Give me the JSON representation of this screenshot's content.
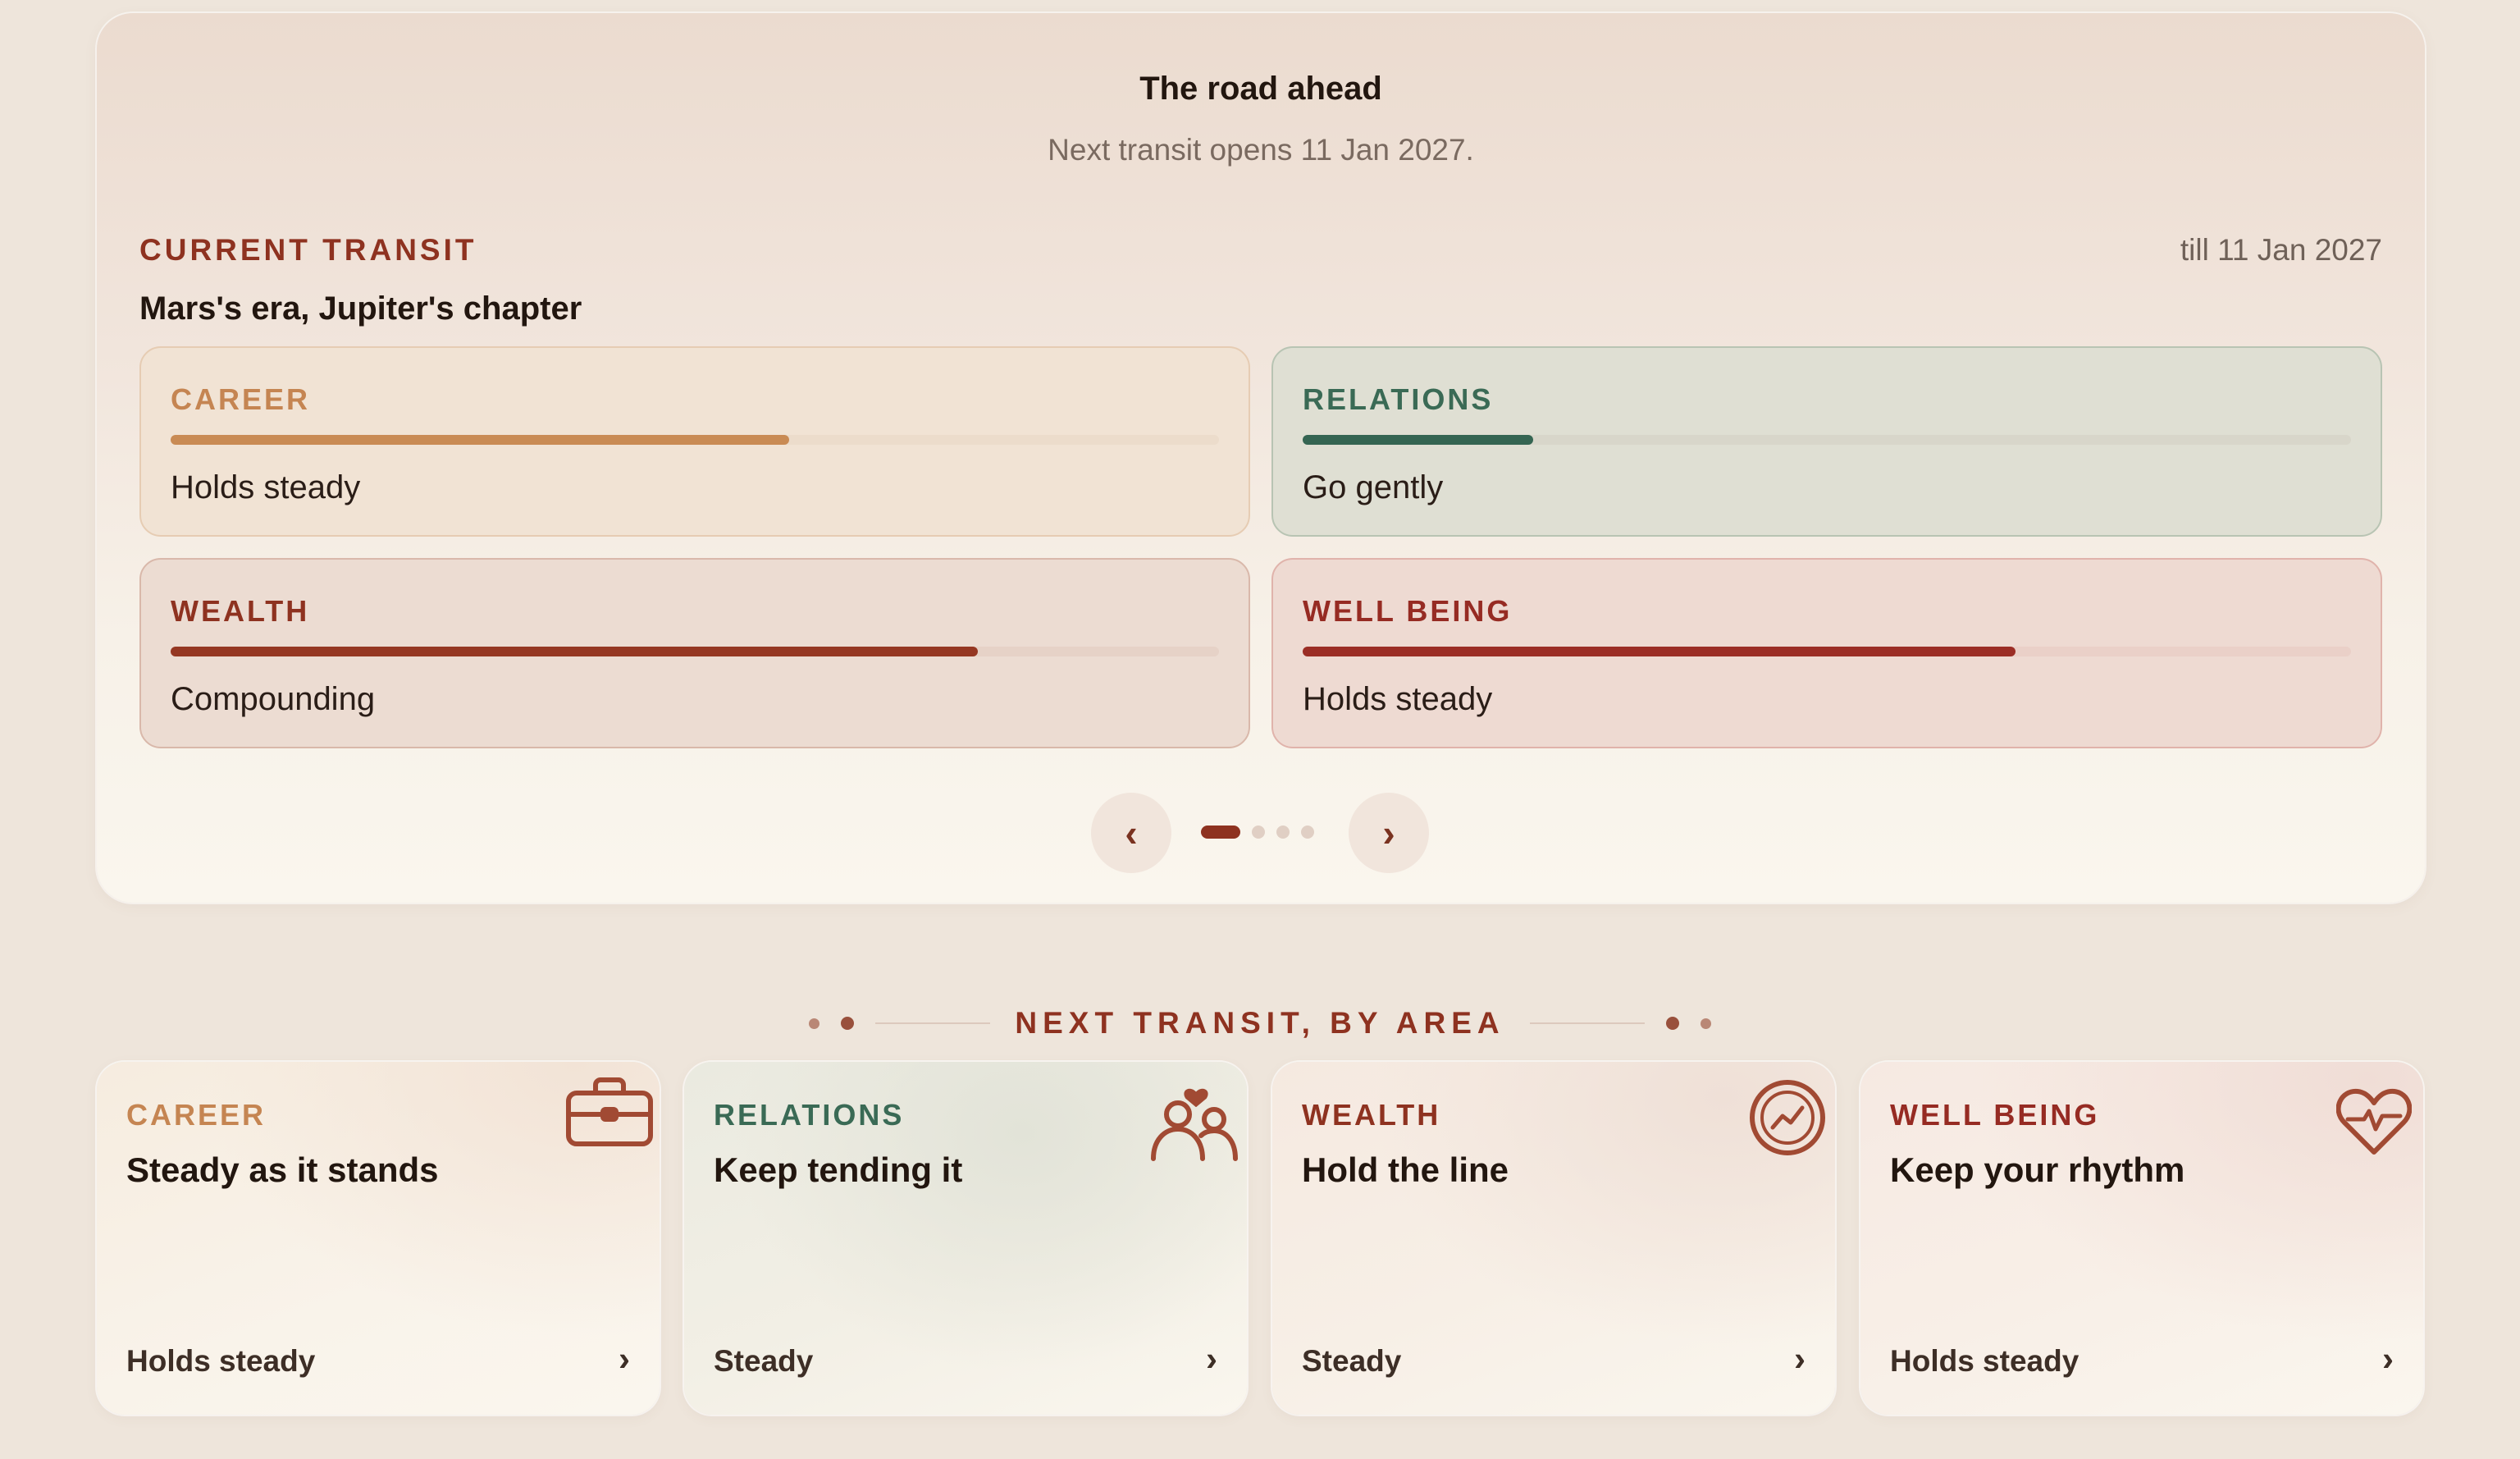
{
  "road": {
    "title": "The road ahead",
    "subtitle": "Next transit opens 11 Jan 2027."
  },
  "current_transit": {
    "eyebrow": "CURRENT TRANSIT",
    "till": "till 11 Jan 2027",
    "name": "Mars's era, Jupiter's chapter",
    "areas": [
      {
        "label": "CAREER",
        "status": "Holds steady",
        "level": 0.59,
        "color": "#c98b54"
      },
      {
        "label": "RELATIONS",
        "status": "Go gently",
        "level": 0.22,
        "color": "#356552"
      },
      {
        "label": "WEALTH",
        "status": "Compounding",
        "level": 0.77,
        "color": "#953722"
      },
      {
        "label": "WELL BEING",
        "status": "Holds steady",
        "level": 0.68,
        "color": "#9b2d25"
      }
    ]
  },
  "carousel": {
    "prev": "‹",
    "next": "›",
    "page_count": 4,
    "active_page": 1
  },
  "next_transit": {
    "heading": "NEXT TRANSIT, BY AREA",
    "cards": [
      {
        "label": "CAREER",
        "headline": "Steady as it stands",
        "status": "Holds steady",
        "icon": "briefcase-icon",
        "chevron": "›"
      },
      {
        "label": "RELATIONS",
        "headline": "Keep tending it",
        "status": "Steady",
        "icon": "people-heart-icon",
        "chevron": "›"
      },
      {
        "label": "WEALTH",
        "headline": "Hold the line",
        "status": "Steady",
        "icon": "growth-coin-icon",
        "chevron": "›"
      },
      {
        "label": "WELL BEING",
        "headline": "Keep your rhythm",
        "status": "Holds steady",
        "icon": "heartbeat-icon",
        "chevron": "›"
      }
    ]
  },
  "colors": {
    "accent": "#8e3220",
    "background": "#eee5db"
  }
}
